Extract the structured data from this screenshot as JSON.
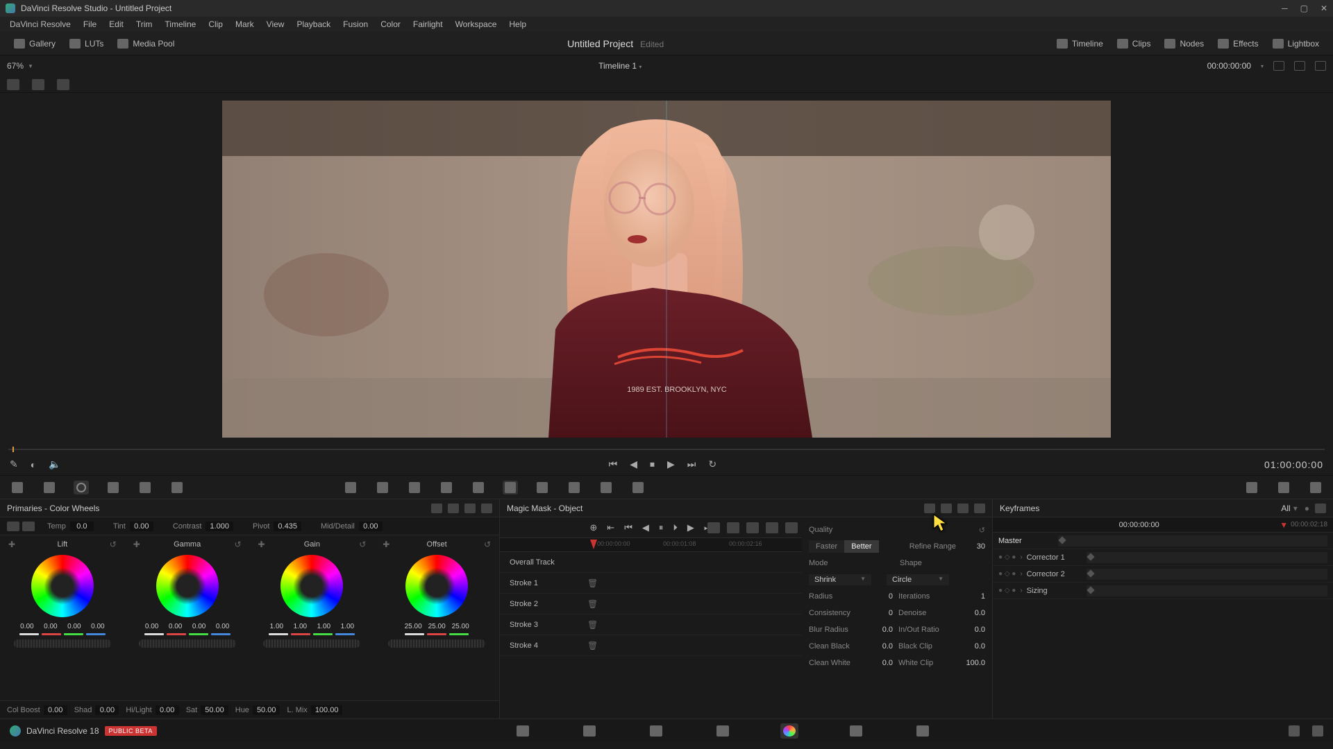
{
  "window": {
    "title": "DaVinci Resolve Studio - Untitled Project"
  },
  "menu": [
    "DaVinci Resolve",
    "File",
    "Edit",
    "Trim",
    "Timeline",
    "Clip",
    "Mark",
    "View",
    "Playback",
    "Fusion",
    "Color",
    "Fairlight",
    "Workspace",
    "Help"
  ],
  "topbar": {
    "left": [
      {
        "name": "gallery-button",
        "label": "Gallery"
      },
      {
        "name": "luts-button",
        "label": "LUTs"
      },
      {
        "name": "media-pool-button",
        "label": "Media Pool"
      }
    ],
    "project_title": "Untitled Project",
    "edited": "Edited",
    "right": [
      {
        "name": "timeline-button",
        "label": "Timeline"
      },
      {
        "name": "clips-button",
        "label": "Clips"
      },
      {
        "name": "nodes-button",
        "label": "Nodes"
      },
      {
        "name": "effects-button",
        "label": "Effects"
      },
      {
        "name": "lightbox-button",
        "label": "Lightbox"
      }
    ]
  },
  "viewer": {
    "zoom": "67%",
    "timeline_name": "Timeline 1",
    "timecode": "00:00:00:00"
  },
  "transport": {
    "timecode": "01:00:00:00"
  },
  "primaries": {
    "title": "Primaries - Color Wheels",
    "top": {
      "temp": {
        "label": "Temp",
        "value": "0.0"
      },
      "tint": {
        "label": "Tint",
        "value": "0.00"
      },
      "contrast": {
        "label": "Contrast",
        "value": "1.000"
      },
      "pivot": {
        "label": "Pivot",
        "value": "0.435"
      },
      "middetail": {
        "label": "Mid/Detail",
        "value": "0.00"
      }
    },
    "wheels": [
      {
        "name": "Lift",
        "vals": [
          "0.00",
          "0.00",
          "0.00",
          "0.00"
        ]
      },
      {
        "name": "Gamma",
        "vals": [
          "0.00",
          "0.00",
          "0.00",
          "0.00"
        ]
      },
      {
        "name": "Gain",
        "vals": [
          "1.00",
          "1.00",
          "1.00",
          "1.00"
        ]
      },
      {
        "name": "Offset",
        "vals": [
          "25.00",
          "25.00",
          "25.00"
        ]
      }
    ],
    "bottom": {
      "colboost": {
        "label": "Col Boost",
        "value": "0.00"
      },
      "shad": {
        "label": "Shad",
        "value": "0.00"
      },
      "hilight": {
        "label": "Hi/Light",
        "value": "0.00"
      },
      "sat": {
        "label": "Sat",
        "value": "50.00"
      },
      "hue": {
        "label": "Hue",
        "value": "50.00"
      },
      "lmix": {
        "label": "L. Mix",
        "value": "100.00"
      }
    }
  },
  "magicmask": {
    "title": "Magic Mask - Object",
    "ticks": [
      "00:00:00:00",
      "00:00:01:08",
      "00:00:02:16"
    ],
    "strokes": [
      "Overall Track",
      "Stroke 1",
      "Stroke 2",
      "Stroke 3",
      "Stroke 4"
    ],
    "quality_label": "Quality",
    "quality_opts": [
      "Faster",
      "Better"
    ],
    "quality_active": "Better",
    "refine_range": {
      "label": "Refine Range",
      "value": "30"
    },
    "mode": {
      "label": "Mode",
      "value": "Shrink"
    },
    "shape": {
      "label": "Shape",
      "value": "Circle"
    },
    "rows": [
      {
        "l": "Radius",
        "v": "0",
        "l2": "Iterations",
        "v2": "1"
      },
      {
        "l": "Consistency",
        "v": "0",
        "l2": "Denoise",
        "v2": "0.0"
      },
      {
        "l": "Blur Radius",
        "v": "0.0",
        "l2": "In/Out Ratio",
        "v2": "0.0"
      },
      {
        "l": "Clean Black",
        "v": "0.0",
        "l2": "Black Clip",
        "v2": "0.0"
      },
      {
        "l": "Clean White",
        "v": "0.0",
        "l2": "White Clip",
        "v2": "100.0"
      }
    ]
  },
  "keyframes": {
    "title": "Keyframes",
    "filter": "All",
    "head_tc": "00:00:00:00",
    "head_tc2": "00:00:02:18",
    "rows": [
      {
        "name": "Master",
        "master": true
      },
      {
        "name": "Corrector 1"
      },
      {
        "name": "Corrector 2"
      },
      {
        "name": "Sizing"
      }
    ]
  },
  "footer": {
    "brand": "DaVinci Resolve 18",
    "badge": "PUBLIC BETA"
  }
}
